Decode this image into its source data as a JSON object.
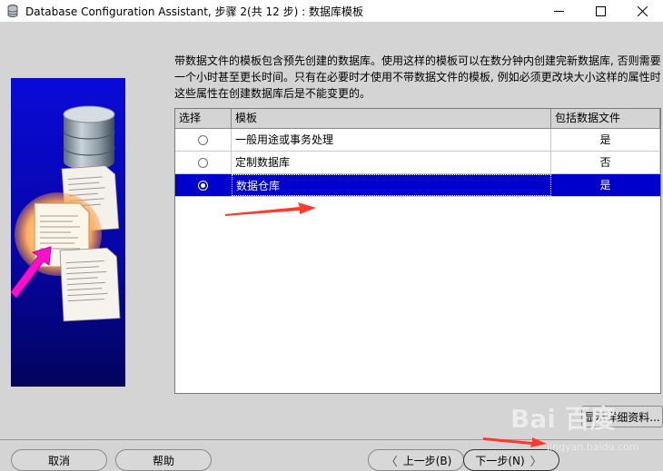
{
  "window": {
    "title": "Database Configuration Assistant, 步骤 2(共 12 步) : 数据库模板",
    "minimize_glyph": "—",
    "maximize_glyph": "☐",
    "close_glyph": "✕"
  },
  "description": {
    "line1": "带数据文件的模板包含预先创建的数据库。使用这样的模板可以在数分钟内创建完新数据库, 否则需要",
    "line2": "一个小时甚至更长时间。只有在必要时才使用不带数据文件的模板, 例如必须更改块大小这样的属性时,",
    "line3": "这些属性在创建数据库后是不能变更的。"
  },
  "table": {
    "headers": {
      "select": "选择",
      "template": "模板",
      "includes_datafiles": "包括数据文件"
    },
    "rows": [
      {
        "template": "一般用途或事务处理",
        "includes": "是",
        "selected": false
      },
      {
        "template": "定制数据库",
        "includes": "否",
        "selected": false
      },
      {
        "template": "数据仓库",
        "includes": "是",
        "selected": true
      }
    ]
  },
  "buttons": {
    "details": "显示详细资料...",
    "cancel": "取消",
    "help": "帮助",
    "back": "上一步(B)",
    "next": "下一步(N)",
    "back_glyph": "〈",
    "next_glyph": "〉"
  },
  "watermark": {
    "main": "Bai 百度",
    "sub": "jingyan.baidu.com"
  },
  "colors": {
    "selection": "#0000cc",
    "banner": "#0606a8",
    "annotation_arrow": "#ff3b30",
    "banner_arrow": "#ff00cc"
  }
}
